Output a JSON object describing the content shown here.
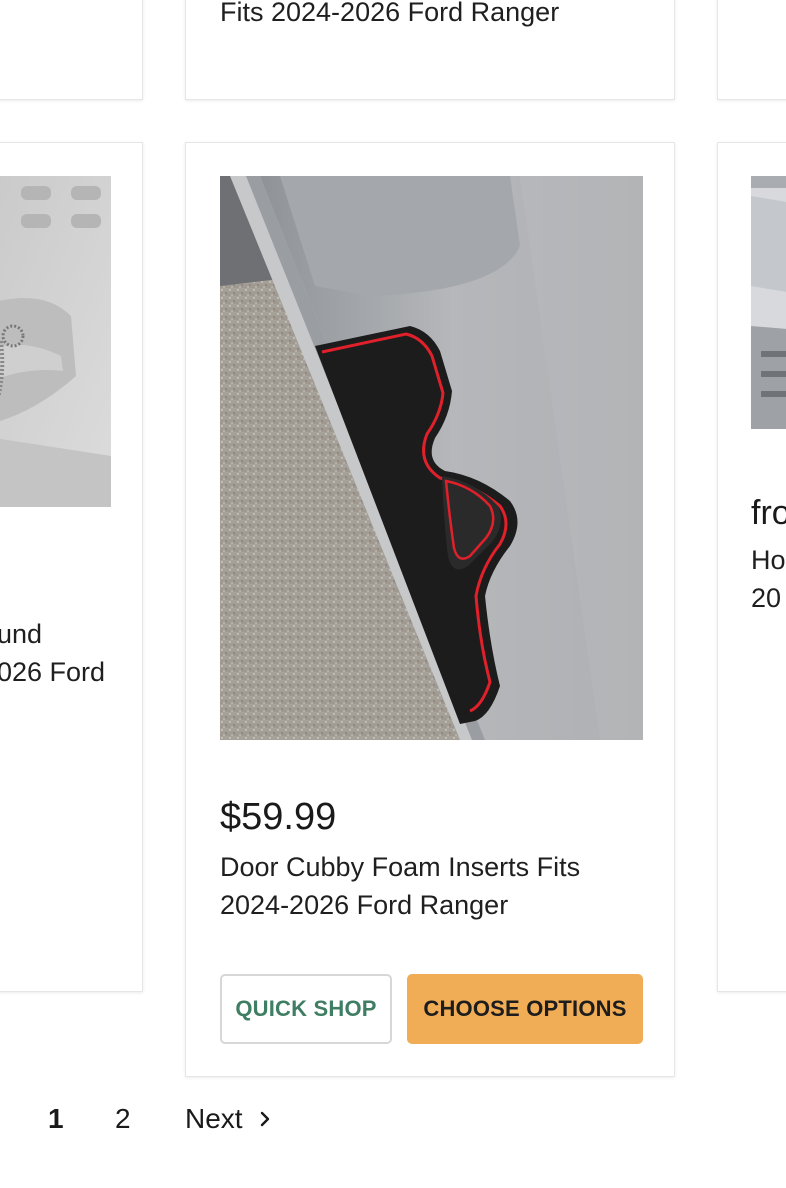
{
  "top_row": {
    "center_card_title": "Fits 2024-2026 Ford Ranger"
  },
  "left_card": {
    "title_line1": "und",
    "title_line2": "026 Ford"
  },
  "center_card": {
    "image_alt": "Door cubby foam insert",
    "price": "$59.99",
    "title_line1": "Door Cubby Foam Inserts Fits",
    "title_line2": "2024-2026 Ford Ranger",
    "quick_shop_label": "QUICK SHOP",
    "choose_options_label": "CHOOSE OPTIONS"
  },
  "right_card": {
    "price_partial": "fro",
    "title_line1": "Ho",
    "title_line2": "20"
  },
  "pagination": {
    "pages": [
      "1",
      "2"
    ],
    "current": "1",
    "next_label": "Next",
    "next_icon": "chevron-right-icon"
  },
  "colors": {
    "accent_button": "#f1ad55",
    "quick_shop_text": "#3f7e63",
    "insert_red": "#e0202a"
  }
}
